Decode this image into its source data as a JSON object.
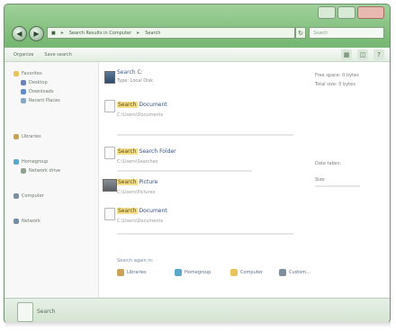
{
  "window": {
    "address_path": [
      "Search Results in Computer",
      "Search"
    ],
    "search_query": "",
    "search_placeholder": "Search"
  },
  "toolbar": {
    "organize_label": "Organize",
    "save_search_label": "Save search",
    "views_label": "Views"
  },
  "nav": {
    "favorites": "Favorites",
    "items": [
      "Desktop",
      "Downloads",
      "Recent Places"
    ],
    "libraries": "Libraries",
    "homegroup": "Homegroup",
    "homegroup_sub": "Network drive",
    "computer": "Computer",
    "network": "Network"
  },
  "results": {
    "drive": {
      "title": "Search C:",
      "sub": "Type: Local Disk",
      "free_label": "Free space:",
      "free_value": "0 bytes",
      "total_label": "Total size:",
      "total_value": "0 bytes"
    },
    "items": [
      {
        "title": "Document",
        "highlight": "Search",
        "path": "C:\\Users\\Documents"
      },
      {
        "title": "Search Folder",
        "highlight": "Search",
        "path": "C:\\Users\\Searches"
      },
      {
        "title": "Picture",
        "highlight": "Search",
        "path": "C:\\Users\\Pictures",
        "date_label": "Date taken:",
        "size_label": "Size:"
      },
      {
        "title": "Document",
        "highlight": "Search",
        "path": "C:\\Users\\Documents"
      }
    ]
  },
  "search_again": {
    "label": "Search again in:",
    "options": [
      "Libraries",
      "Homegroup",
      "Computer",
      "Custom..."
    ]
  },
  "details": {
    "text": "Search"
  },
  "colors": {
    "frame": "#79b874",
    "highlight": "#f6df8a",
    "link": "#354e76"
  }
}
